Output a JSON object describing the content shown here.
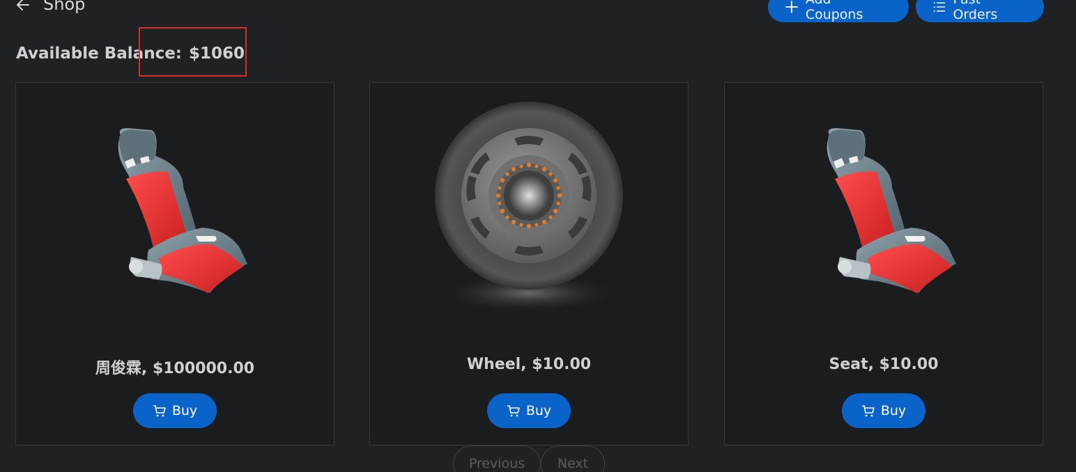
{
  "header": {
    "title": "Shop",
    "add_coupons_label": "Add Coupons",
    "past_orders_label": "Past Orders"
  },
  "balance": {
    "label": "Available Balance:",
    "value": "$1060"
  },
  "products": [
    {
      "label": "周俊霖, $100000.00",
      "buy_label": "Buy",
      "image": "racing-seat"
    },
    {
      "label": "Wheel, $10.00",
      "buy_label": "Buy",
      "image": "wheel"
    },
    {
      "label": "Seat, $10.00",
      "buy_label": "Buy",
      "image": "racing-seat"
    }
  ],
  "pagination": {
    "previous_label": "Previous",
    "next_label": "Next"
  },
  "colors": {
    "accent": "#0a63c9",
    "background": "#1f2224",
    "card": "#1b1c1e",
    "highlight": "#e32626"
  }
}
